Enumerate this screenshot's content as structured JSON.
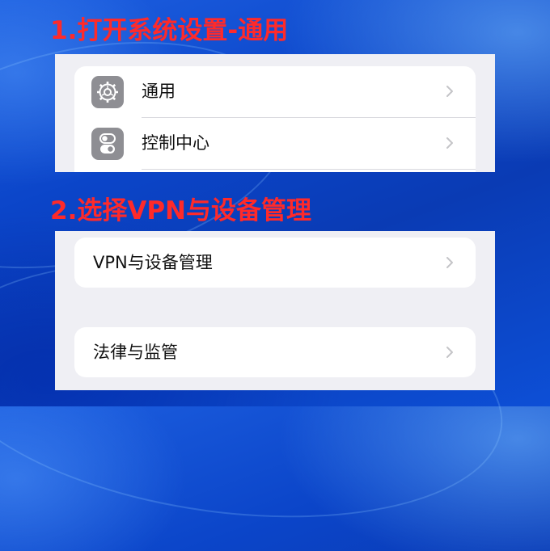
{
  "steps": [
    {
      "title": "1.打开系统设置-通用",
      "items": [
        {
          "label": "通用",
          "icon": "gear-icon"
        },
        {
          "label": "控制中心",
          "icon": "toggles-icon"
        }
      ]
    },
    {
      "title": "2.选择VPN与设备管理",
      "items": [
        {
          "label": "VPN与设备管理"
        },
        {
          "label": "法律与监管"
        }
      ]
    }
  ],
  "colors": {
    "step_title": "#ff2a2a",
    "background_blue": "#0a3bb4",
    "panel_gray": "#efeff4",
    "card_white": "#ffffff",
    "icon_gray": "#8e8e93",
    "chevron_gray": "#c4c4c7"
  }
}
